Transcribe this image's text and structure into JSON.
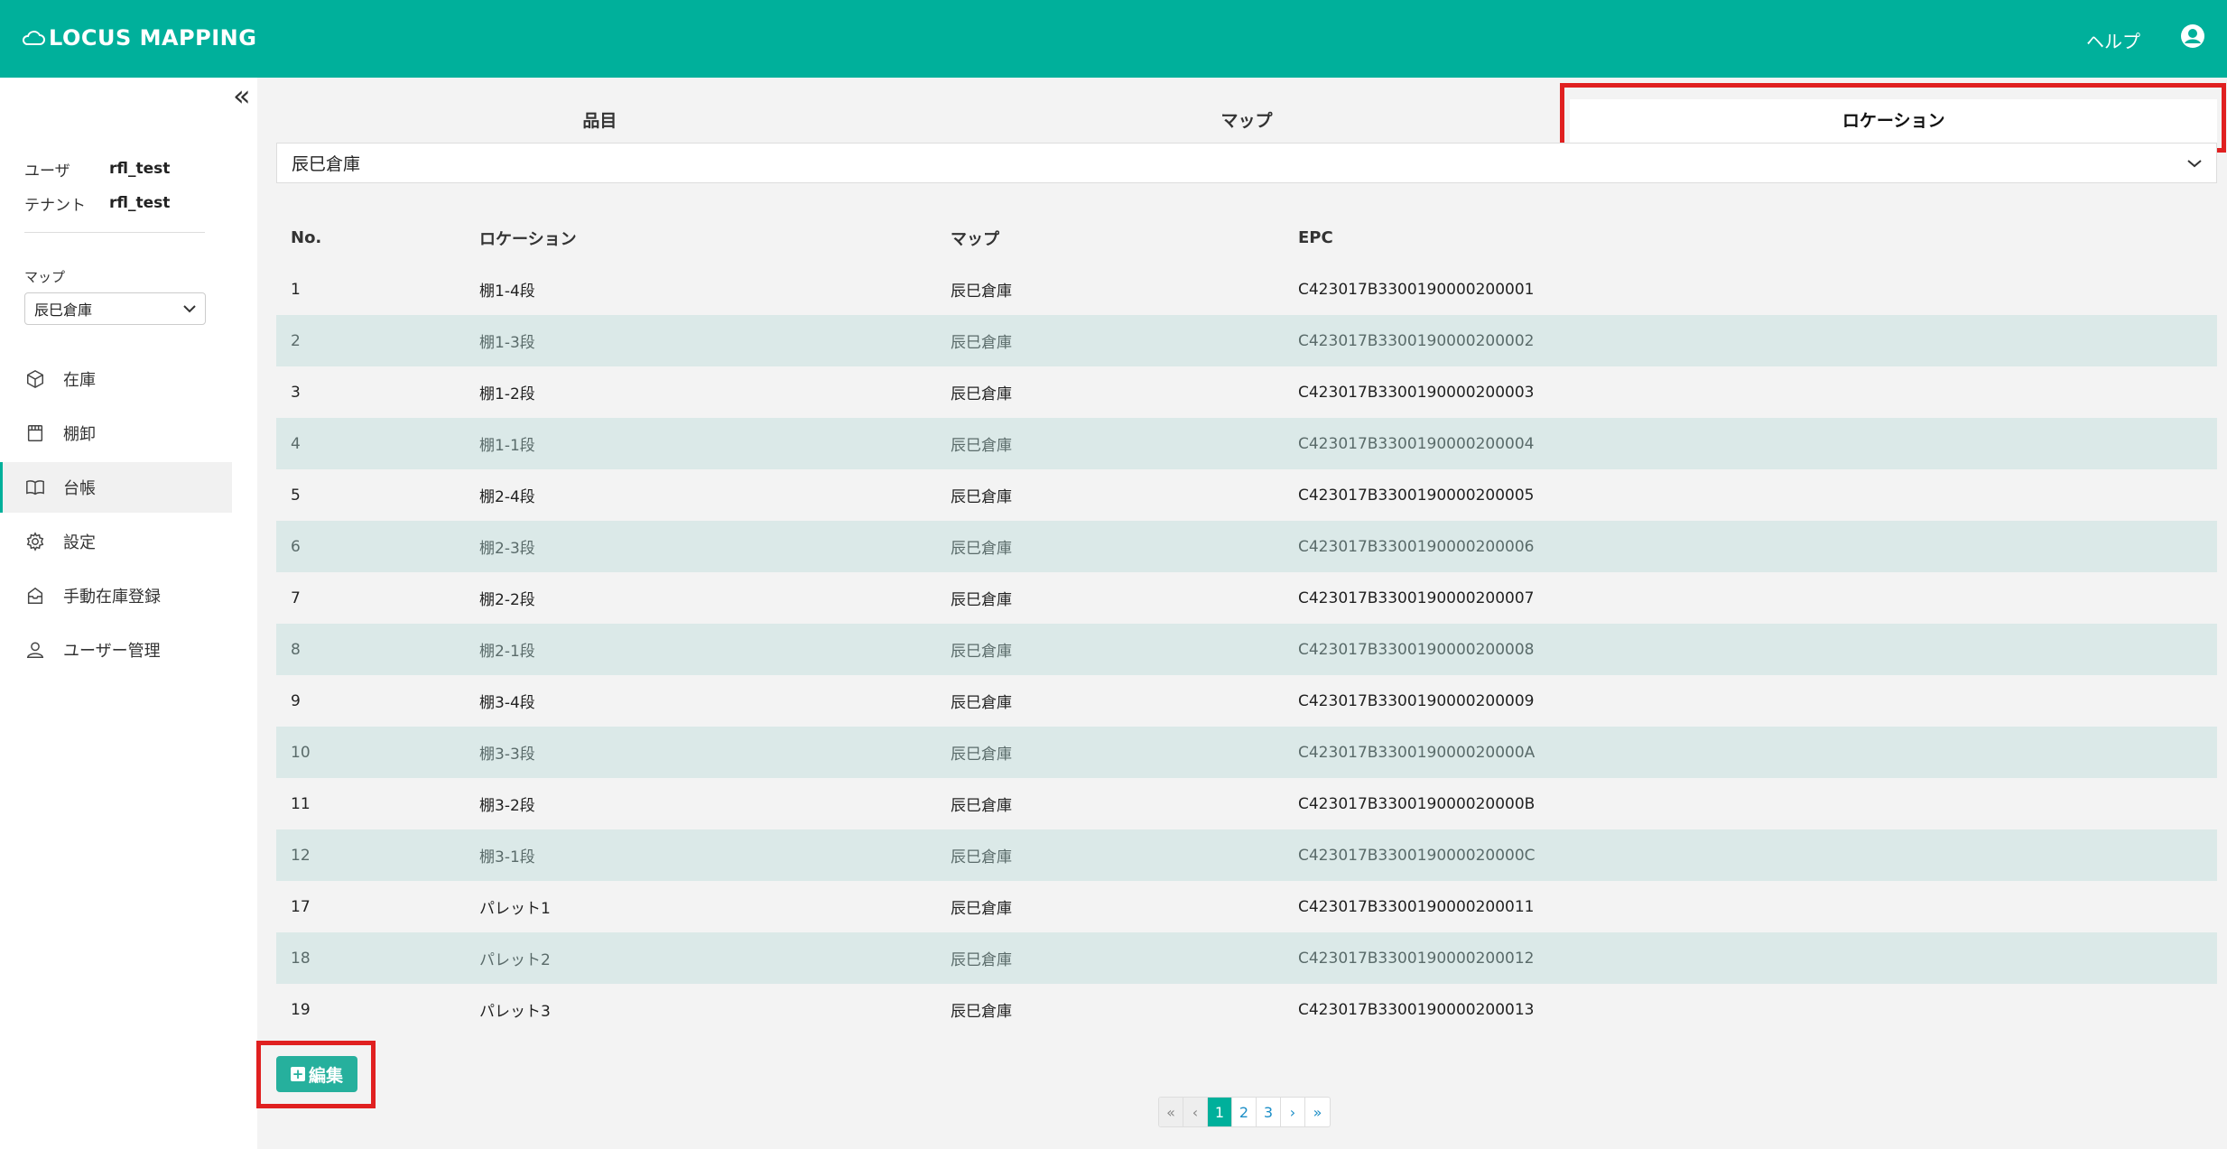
{
  "header": {
    "logo_text": "LOCUS MAPPING",
    "help_label": "ヘルプ",
    "account_icon": "account-circle-icon",
    "brand_color": "#00b09b"
  },
  "sidebar": {
    "collapse_label": "«",
    "user_label": "ユーザ",
    "user_value": "rfl_test",
    "tenant_label": "テナント",
    "tenant_value": "rfl_test",
    "map_label": "マップ",
    "map_selected": "辰巳倉庫",
    "nav": [
      {
        "label": "在庫",
        "icon": "box-icon"
      },
      {
        "label": "棚卸",
        "icon": "calendar-icon"
      },
      {
        "label": "台帳",
        "icon": "book-icon",
        "active": true
      },
      {
        "label": "設定",
        "icon": "gear-icon"
      },
      {
        "label": "手動在庫登録",
        "icon": "inbox-icon"
      },
      {
        "label": "ユーザー管理",
        "icon": "user-icon"
      }
    ]
  },
  "tabs": [
    {
      "label": "品目"
    },
    {
      "label": "マップ"
    },
    {
      "label": "ロケーション",
      "active": true
    }
  ],
  "warehouse_select": {
    "selected": "辰巳倉庫"
  },
  "table": {
    "headers": [
      "No.",
      "ロケーション",
      "マップ",
      "EPC"
    ],
    "rows": [
      [
        "1",
        "棚1-4段",
        "辰巳倉庫",
        "C423017B3300190000200001"
      ],
      [
        "2",
        "棚1-3段",
        "辰巳倉庫",
        "C423017B3300190000200002"
      ],
      [
        "3",
        "棚1-2段",
        "辰巳倉庫",
        "C423017B3300190000200003"
      ],
      [
        "4",
        "棚1-1段",
        "辰巳倉庫",
        "C423017B3300190000200004"
      ],
      [
        "5",
        "棚2-4段",
        "辰巳倉庫",
        "C423017B3300190000200005"
      ],
      [
        "6",
        "棚2-3段",
        "辰巳倉庫",
        "C423017B3300190000200006"
      ],
      [
        "7",
        "棚2-2段",
        "辰巳倉庫",
        "C423017B3300190000200007"
      ],
      [
        "8",
        "棚2-1段",
        "辰巳倉庫",
        "C423017B3300190000200008"
      ],
      [
        "9",
        "棚3-4段",
        "辰巳倉庫",
        "C423017B3300190000200009"
      ],
      [
        "10",
        "棚3-3段",
        "辰巳倉庫",
        "C423017B330019000020000A"
      ],
      [
        "11",
        "棚3-2段",
        "辰巳倉庫",
        "C423017B330019000020000B"
      ],
      [
        "12",
        "棚3-1段",
        "辰巳倉庫",
        "C423017B330019000020000C"
      ],
      [
        "17",
        "パレット1",
        "辰巳倉庫",
        "C423017B3300190000200011"
      ],
      [
        "18",
        "パレット2",
        "辰巳倉庫",
        "C423017B3300190000200012"
      ],
      [
        "19",
        "パレット3",
        "辰巳倉庫",
        "C423017B3300190000200013"
      ]
    ]
  },
  "edit_button": {
    "label": "編集"
  },
  "pagination": {
    "first": "«",
    "prev": "‹",
    "pages": [
      "1",
      "2",
      "3"
    ],
    "current": "1",
    "next": "›",
    "last": "»"
  }
}
